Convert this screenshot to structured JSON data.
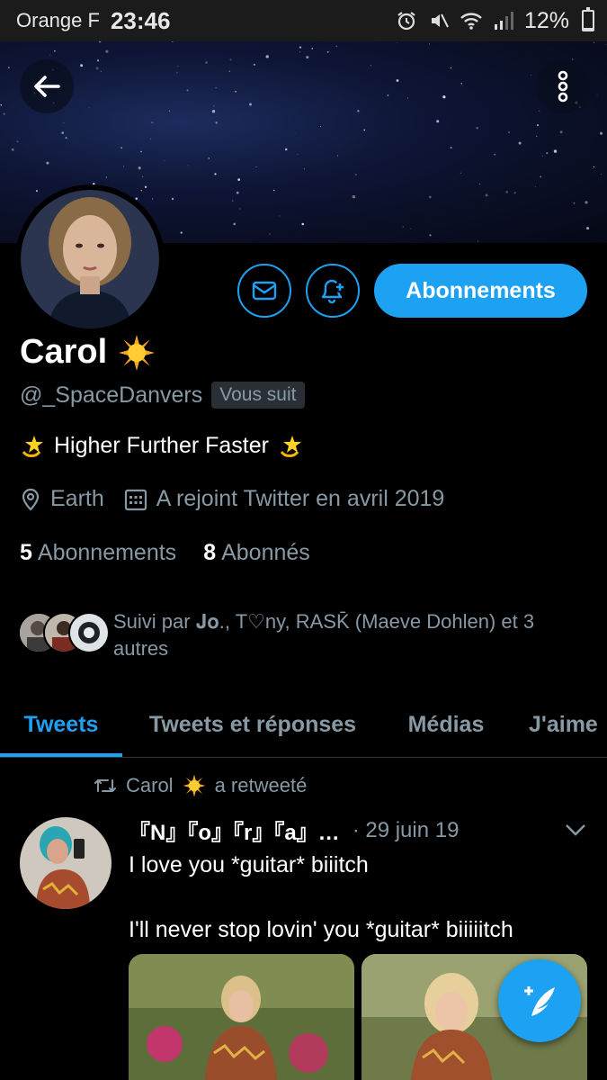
{
  "status_bar": {
    "carrier": "Orange F",
    "time": "23:46",
    "battery": "12%",
    "battery_level": 0.12,
    "icons": [
      "alarm-icon",
      "mute-icon",
      "wifi-icon",
      "signal-icon",
      "battery-icon"
    ]
  },
  "header": {
    "back_icon": "arrow-left-icon",
    "more_icon": "vertical-dots-icon"
  },
  "profile": {
    "name": "Carol",
    "name_emoji": "sun-emoji",
    "handle": "@_SpaceDanvers",
    "follows_you": "Vous suit",
    "bio": "Higher Further Faster",
    "bio_emoji": "dizzy-star-emoji",
    "location": "Earth",
    "joined": "A rejoint Twitter en avril 2019",
    "following_count": "5",
    "following_label": "Abonnements",
    "followers_count": "8",
    "followers_label": "Abonnés",
    "followed_by": "Suivi par 𝐉𝐨., T♡ny, RASK̄ (Maeve Dohlen) et 3 autres"
  },
  "actions": {
    "message_icon": "envelope-icon",
    "notify_icon": "bell-plus-icon",
    "follow_label": "Abonnements"
  },
  "tabs": [
    {
      "label": "Tweets",
      "active": true
    },
    {
      "label": "Tweets et réponses",
      "active": false
    },
    {
      "label": "Médias",
      "active": false
    },
    {
      "label": "J'aime",
      "active": false
    }
  ],
  "tweet": {
    "retweet_by": "Carol",
    "retweet_suffix": "a retweeté",
    "author": "『N』『o』『r』『a』…",
    "date": "· 29 juin 19",
    "text_line1": "I love you *guitar* biiitch",
    "text_line2": "I'll never stop lovin' you *guitar* biiiiitch"
  },
  "fab": {
    "icon": "compose-tweet-icon"
  },
  "colors": {
    "accent": "#1da1f2",
    "background": "#000000",
    "secondary_text": "#8899a6"
  }
}
